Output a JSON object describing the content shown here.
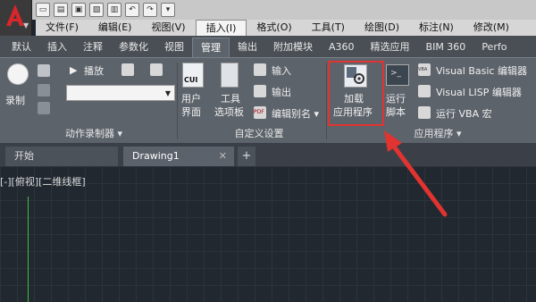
{
  "menubar": {
    "items": [
      "文件(F)",
      "编辑(E)",
      "视图(V)",
      "插入(I)",
      "格式(O)",
      "工具(T)",
      "绘图(D)",
      "标注(N)",
      "修改(M)"
    ],
    "active_index": 3
  },
  "ribbon_tabs": {
    "items": [
      "默认",
      "插入",
      "注释",
      "参数化",
      "视图",
      "管理",
      "输出",
      "附加模块",
      "A360",
      "精选应用",
      "BIM 360",
      "Perfo"
    ],
    "active_index": 5
  },
  "panels": {
    "action_recorder": {
      "record_label": "录制",
      "play_label": "播放",
      "title": "动作录制器"
    },
    "customize": {
      "user_interface_l1": "用户",
      "user_interface_l2": "界面",
      "tool_palettes_l1": "工具",
      "tool_palettes_l2": "选项板",
      "import_label": "输入",
      "export_label": "输出",
      "edit_aliases_label": "编辑别名",
      "title": "自定义设置"
    },
    "applications": {
      "load_app_l1": "加载",
      "load_app_l2": "应用程序",
      "run_script_l1": "运行",
      "run_script_l2": "脚本",
      "vba_editor": "Visual Basic 编辑器",
      "lisp_editor": "Visual LISP 编辑器",
      "run_vba": "运行 VBA 宏",
      "title": "应用程序"
    }
  },
  "icons": {
    "cui": "CUI",
    "pdf": "PDF",
    "vba": "VBA"
  },
  "doc_tabs": {
    "start": "开始",
    "drawing": "Drawing1",
    "close": "✕",
    "plus": "+"
  },
  "viewport_label": "[-][俯视][二维线框]",
  "colors": {
    "highlight": "#e1332f",
    "ribbon_bg": "#5d636b",
    "canvas_bg": "#212830",
    "ucs_axis": "#3fbf3f"
  }
}
